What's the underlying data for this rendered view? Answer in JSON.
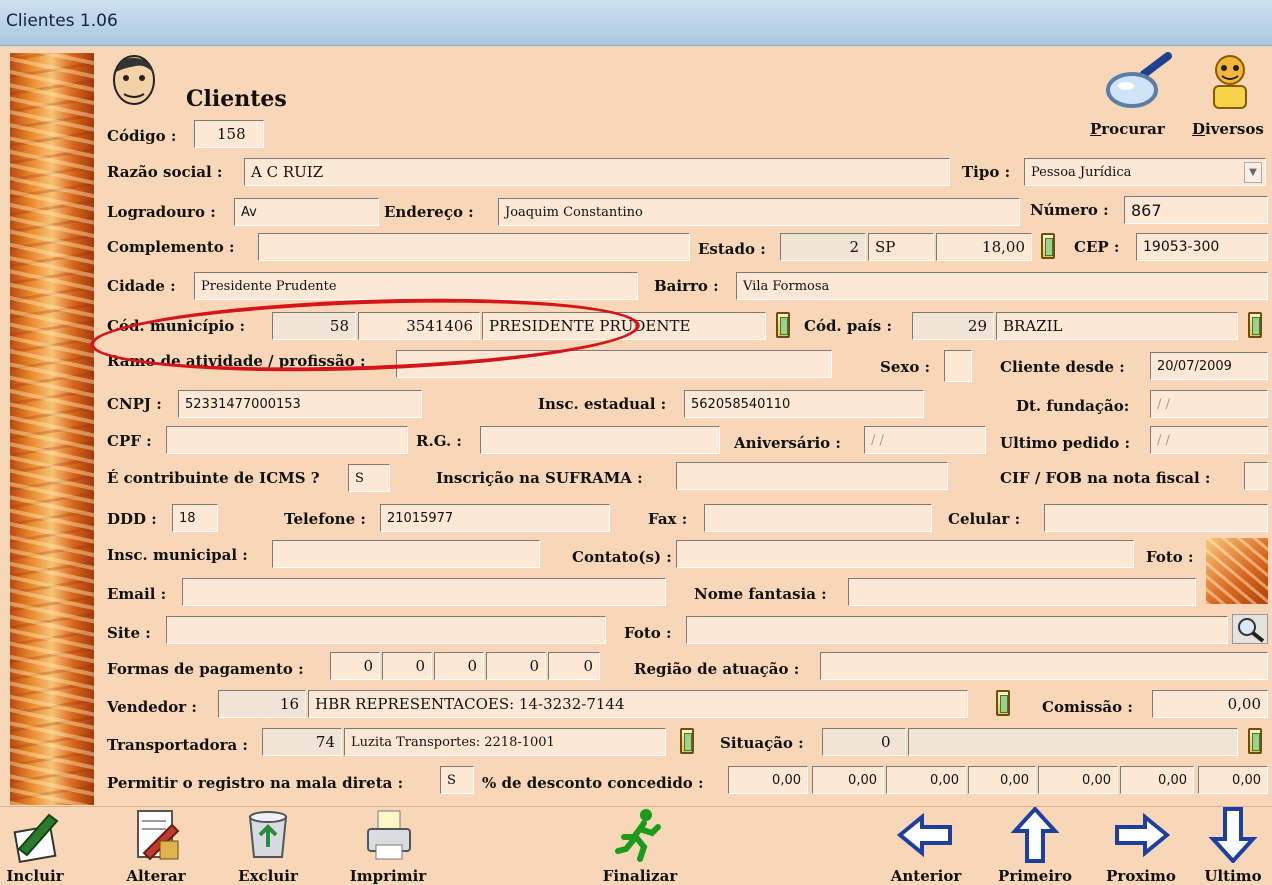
{
  "window": {
    "title": "Clientes 1.06"
  },
  "header": {
    "title": "Clientes",
    "procurar": "Procurar",
    "diversos": "Diversos"
  },
  "fields": {
    "codigo": {
      "label": "Código :",
      "value": "158"
    },
    "razao_social": {
      "label": "Razão social :",
      "value": "A C RUIZ"
    },
    "tipo": {
      "label": "Tipo :",
      "value": "Pessoa Jurídica"
    },
    "logradouro": {
      "label": "Logradouro :",
      "value": "Av"
    },
    "endereco": {
      "label": "Endereço :",
      "value": "Joaquim Constantino"
    },
    "numero": {
      "label": "Número :",
      "value": "867"
    },
    "complemento": {
      "label": "Complemento :",
      "value": ""
    },
    "estado": {
      "label": "Estado :",
      "code": "2",
      "uf": "SP",
      "aliquota": "18,00"
    },
    "cep": {
      "label": "CEP :",
      "value": "19053-300"
    },
    "cidade": {
      "label": "Cidade :",
      "value": "Presidente Prudente"
    },
    "bairro": {
      "label": "Bairro :",
      "value": "Vila Formosa"
    },
    "cod_municipio": {
      "label": "Cód. município :",
      "code": "58",
      "ibge": "3541406",
      "name": "PRESIDENTE PRUDENTE"
    },
    "cod_pais": {
      "label": "Cód. país :",
      "code": "29",
      "name": "BRAZIL"
    },
    "ramo": {
      "label": "Ramo de atividade / profissão :",
      "value": ""
    },
    "sexo": {
      "label": "Sexo :",
      "value": ""
    },
    "cliente_desde": {
      "label": "Cliente desde :",
      "value": "20/07/2009"
    },
    "cnpj": {
      "label": "CNPJ :",
      "value": "52331477000153"
    },
    "insc_estadual": {
      "label": "Insc. estadual :",
      "value": "562058540110"
    },
    "dt_fundacao": {
      "label": "Dt. fundação:",
      "value": " / /"
    },
    "cpf": {
      "label": "CPF :",
      "value": ""
    },
    "rg": {
      "label": "R.G. :",
      "value": ""
    },
    "aniversario": {
      "label": "Aniversário :",
      "value": " / /"
    },
    "ultimo_pedido": {
      "label": "Ultimo pedido :",
      "value": " / /"
    },
    "contribuinte_icms": {
      "label": "É contribuinte de ICMS ?",
      "value": "S"
    },
    "suframa": {
      "label": "Inscrição na SUFRAMA :",
      "value": ""
    },
    "cif_fob": {
      "label": "CIF / FOB na nota fiscal :",
      "value": ""
    },
    "ddd": {
      "label": "DDD :",
      "value": "18"
    },
    "telefone": {
      "label": "Telefone :",
      "value": "21015977"
    },
    "fax": {
      "label": "Fax :",
      "value": ""
    },
    "celular": {
      "label": "Celular :",
      "value": ""
    },
    "insc_municipal": {
      "label": "Insc. municipal :",
      "value": ""
    },
    "contatos": {
      "label": "Contato(s) :",
      "value": ""
    },
    "foto_label": "Foto :",
    "email": {
      "label": "Email :",
      "value": ""
    },
    "nome_fantasia": {
      "label": "Nome fantasia :",
      "value": ""
    },
    "site": {
      "label": "Site :",
      "value": ""
    },
    "foto_path": {
      "label": "Foto :",
      "value": ""
    },
    "formas_pagamento": {
      "label": "Formas de pagamento :",
      "values": [
        "0",
        "0",
        "0",
        "0",
        "0"
      ]
    },
    "regiao_atuacao": {
      "label": "Região de atuação :",
      "value": ""
    },
    "vendedor": {
      "label": "Vendedor :",
      "code": "16",
      "name": "HBR REPRESENTACOES: 14-3232-7144"
    },
    "comissao": {
      "label": "Comissão :",
      "value": "0,00"
    },
    "transportadora": {
      "label": "Transportadora :",
      "code": "74",
      "name": "Luzita Transportes: 2218-1001"
    },
    "situacao": {
      "label": "Situação :",
      "code": "0",
      "name": ""
    },
    "mala_direta": {
      "label": "Permitir o registro na mala direta :",
      "value": "S"
    },
    "desconto": {
      "label": "% de desconto concedido :",
      "values": [
        "0,00",
        "0,00",
        "0,00",
        "0,00",
        "0,00",
        "0,00",
        "0,00"
      ]
    }
  },
  "toolbar": {
    "incluir": "Incluir",
    "alterar": "Alterar",
    "excluir": "Excluir",
    "imprimir": "Imprimir",
    "finalizar": "Finalizar",
    "anterior": "Anterior",
    "primeiro": "Primeiro",
    "proximo": "Proximo",
    "ultimo": "Ultimo"
  },
  "colors": {
    "background": "#f8d7b8",
    "field": "#fde8d6",
    "annotation": "#d4161b",
    "titlebar": "#b9d2ea"
  }
}
